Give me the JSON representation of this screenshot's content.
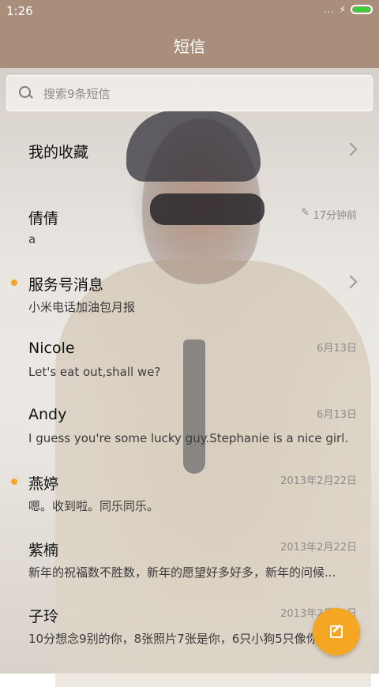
{
  "status_bar": {
    "time": "1:26",
    "signal": "...",
    "charging": "⚡"
  },
  "header": {
    "title": "短信"
  },
  "search": {
    "placeholder": "搜索9条短信"
  },
  "conversations": [
    {
      "name": "我的收藏",
      "preview": "",
      "date": "",
      "unread": false,
      "chevron": true
    },
    {
      "name": "倩倩",
      "preview": "a",
      "date": "17分钟前",
      "draft": true,
      "unread": false
    },
    {
      "name": "服务号消息",
      "preview": "小米电话加油包月报",
      "date": "",
      "unread": true,
      "chevron": true
    },
    {
      "name": "Nicole",
      "preview": "Let's eat out,shall we?",
      "date": "6月13日",
      "unread": false
    },
    {
      "name": "Andy",
      "preview": "I guess you're some lucky guy.Stephanie is a nice girl.",
      "date": "6月13日",
      "unread": false
    },
    {
      "name": "燕婷",
      "preview": "嗯。收到啦。同乐同乐。",
      "date": "2013年2月22日",
      "unread": true
    },
    {
      "name": "紫楠",
      "preview": "新年的祝福数不胜数，新年的愿望好多好多，新年的问候...",
      "date": "2013年2月22日",
      "unread": false
    },
    {
      "name": "子玲",
      "preview": "10分想念9别的你，8张照片7张是你，6只小狗5只像你...",
      "date": "2013年2月22日",
      "unread": false
    }
  ],
  "colors": {
    "accent": "#f5a623",
    "header_bg": "#a98e7c"
  },
  "fab": {
    "icon": "compose-icon"
  }
}
